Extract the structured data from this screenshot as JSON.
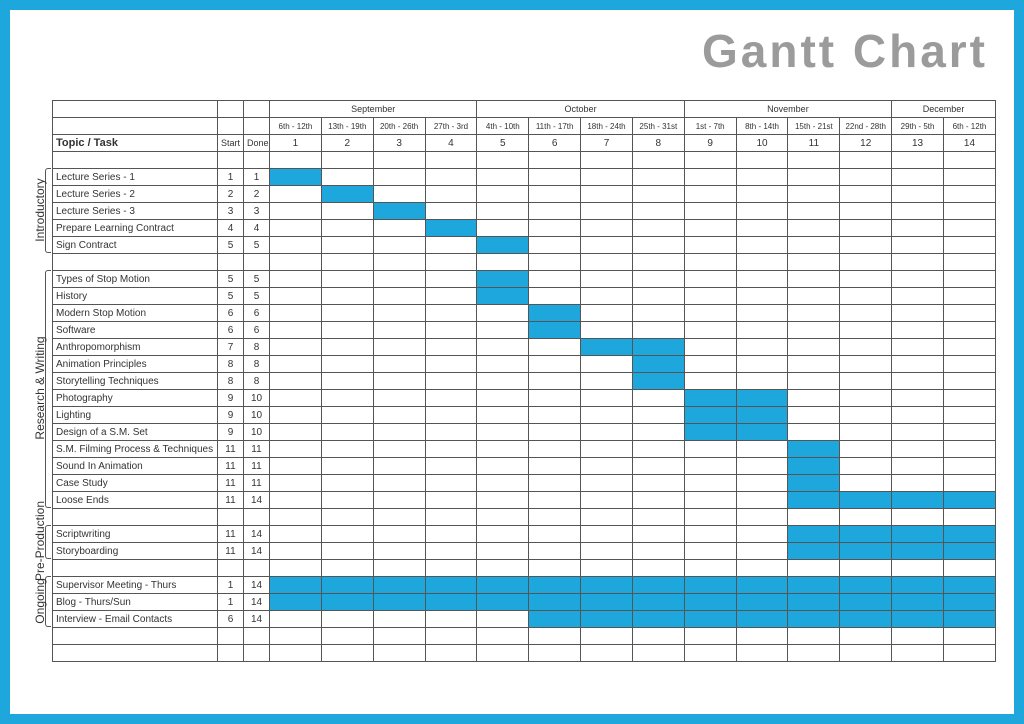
{
  "title": "Gantt Chart",
  "headers": {
    "task": "Topic / Task",
    "start": "Start",
    "done": "Done"
  },
  "months": [
    {
      "name": "September",
      "span": 4
    },
    {
      "name": "October",
      "span": 4
    },
    {
      "name": "November",
      "span": 4
    },
    {
      "name": "December",
      "span": 2
    }
  ],
  "dateranges": [
    "6th - 12th",
    "13th - 19th",
    "20th - 26th",
    "27th - 3rd",
    "4th - 10th",
    "11th - 17th",
    "18th - 24th",
    "25th - 31st",
    "1st - 7th",
    "8th - 14th",
    "15th - 21st",
    "22nd - 28th",
    "29th - 5th",
    "6th - 12th"
  ],
  "weeknums": [
    "1",
    "2",
    "3",
    "4",
    "5",
    "6",
    "7",
    "8",
    "9",
    "10",
    "11",
    "12",
    "13",
    "14"
  ],
  "categories": [
    {
      "name": "Introductory",
      "from": 0,
      "to": 4
    },
    {
      "name": "Research & Writing",
      "from": 5,
      "to": 18
    },
    {
      "name": "Pre-Production",
      "from": 19,
      "to": 20
    },
    {
      "name": "Ongoing",
      "from": 21,
      "to": 23
    }
  ],
  "chart_data": {
    "type": "gantt",
    "x_unit": "week",
    "x_range": [
      1,
      14
    ],
    "tasks": [
      {
        "name": "Lecture Series - 1",
        "start": 1,
        "done": 1
      },
      {
        "name": "Lecture Series - 2",
        "start": 2,
        "done": 2
      },
      {
        "name": "Lecture Series - 3",
        "start": 3,
        "done": 3
      },
      {
        "name": "Prepare Learning Contract",
        "start": 4,
        "done": 4
      },
      {
        "name": "Sign Contract",
        "start": 5,
        "done": 5
      },
      {
        "name": "Types of Stop Motion",
        "start": 5,
        "done": 5
      },
      {
        "name": "History",
        "start": 5,
        "done": 5
      },
      {
        "name": "Modern Stop Motion",
        "start": 6,
        "done": 6
      },
      {
        "name": "Software",
        "start": 6,
        "done": 6
      },
      {
        "name": "Anthropomorphism",
        "start": 7,
        "done": 8
      },
      {
        "name": "Animation Principles",
        "start": 8,
        "done": 8
      },
      {
        "name": "Storytelling Techniques",
        "start": 8,
        "done": 8
      },
      {
        "name": "Photography",
        "start": 9,
        "done": 10
      },
      {
        "name": "Lighting",
        "start": 9,
        "done": 10
      },
      {
        "name": "Design of a S.M. Set",
        "start": 9,
        "done": 10
      },
      {
        "name": "S.M. Filming Process & Techniques",
        "start": 11,
        "done": 11
      },
      {
        "name": "Sound In Animation",
        "start": 11,
        "done": 11
      },
      {
        "name": "Case Study",
        "start": 11,
        "done": 11
      },
      {
        "name": "Loose Ends",
        "start": 11,
        "done": 14
      },
      {
        "name": "Scriptwriting",
        "start": 11,
        "done": 14
      },
      {
        "name": "Storyboarding",
        "start": 11,
        "done": 14
      },
      {
        "name": "Supervisor Meeting - Thurs",
        "start": 1,
        "done": 14
      },
      {
        "name": "Blog - Thurs/Sun",
        "start": 1,
        "done": 14
      },
      {
        "name": "Interview - Email Contacts",
        "start": 6,
        "done": 14
      }
    ]
  }
}
